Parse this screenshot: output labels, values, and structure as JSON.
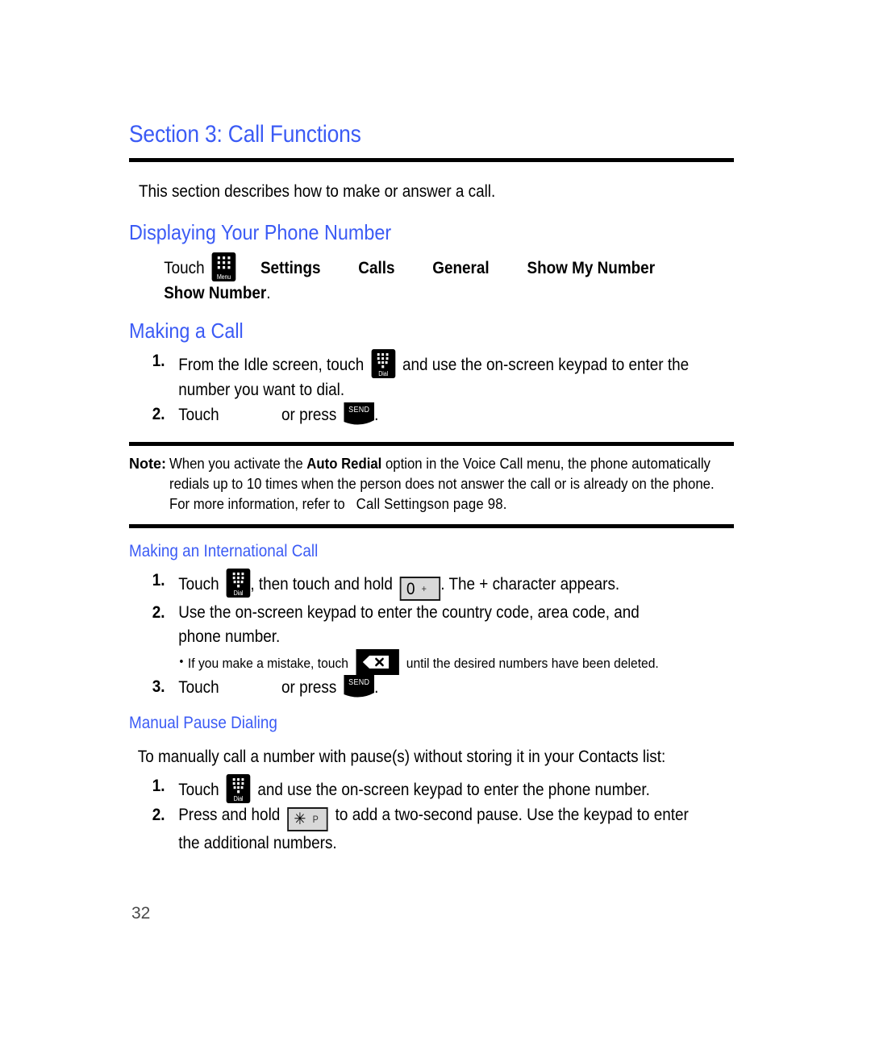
{
  "document": {
    "section_title": "Section 3: Call Functions",
    "intro": "This section describes how to make or answer a call.",
    "page_number": "32"
  },
  "colors": {
    "heading_blue": "#3B5BF5",
    "text_black": "#000000",
    "keycap_gray": "#d8d8d8",
    "page_number_gray": "#4a4a4a"
  },
  "sections": {
    "displaying": {
      "heading": "Displaying Your Phone Number",
      "touch_label": "Touch",
      "menu_icon_label": "Menu",
      "path": [
        "Settings",
        "Calls",
        "General",
        "Show My Number"
      ],
      "final_bold": "Show Number",
      "final_period": "."
    },
    "making_a_call": {
      "heading": "Making a Call",
      "steps": [
        {
          "num": "1.",
          "text_before": "From the Idle screen, touch",
          "icon": "dial-icon",
          "icon_label": "Dial",
          "text_after": "and use the on-screen keypad to enter the",
          "continuation": "number you want to dial."
        },
        {
          "num": "2.",
          "text_before": "Touch",
          "text_mid": "or press",
          "key_label": "SEND",
          "text_after": "."
        }
      ]
    },
    "note": {
      "label": "Note:",
      "line1_a": "When you activate the",
      "line1_bold": "Auto Redial",
      "line1_b": "option in the Voice Call menu, the phone automatically",
      "line2": "redials up to 10 times when the person does not answer the call or is already on the phone.",
      "line3_a": "For more information, refer to",
      "line3_xref": "Call Settings",
      "line3_b": "on page 98."
    },
    "international": {
      "heading": "Making an International Call",
      "steps": [
        {
          "num": "1.",
          "text_before": "Touch",
          "icon_label": "Dial",
          "text_mid": ", then touch and hold",
          "key_main": "0",
          "key_sup": "+",
          "text_after": ". The + character appears."
        },
        {
          "num": "2.",
          "text_before": "Use the on-screen keypad to enter the country code, area code, and",
          "continuation": "phone number."
        }
      ],
      "bullet": {
        "text_before": "If you make a mistake, touch",
        "icon": "backspace-icon",
        "text_after": "until the desired numbers have been deleted."
      },
      "step3": {
        "num": "3.",
        "text_before": "Touch",
        "text_mid": "or press",
        "key_label": "SEND",
        "text_after": "."
      }
    },
    "manual_pause": {
      "heading": "Manual Pause Dialing",
      "intro": "To manually call a number with pause(s) without storing it in your Contacts list:",
      "steps": [
        {
          "num": "1.",
          "text_before": "Touch",
          "icon_label": "Dial",
          "text_after": "and use the on-screen keypad to enter the phone number."
        },
        {
          "num": "2.",
          "text_before": "Press and hold",
          "key_main": "✳",
          "key_sup": "P",
          "text_after": "to add a two-second pause. Use the keypad to enter",
          "continuation": "the additional numbers."
        }
      ]
    }
  }
}
